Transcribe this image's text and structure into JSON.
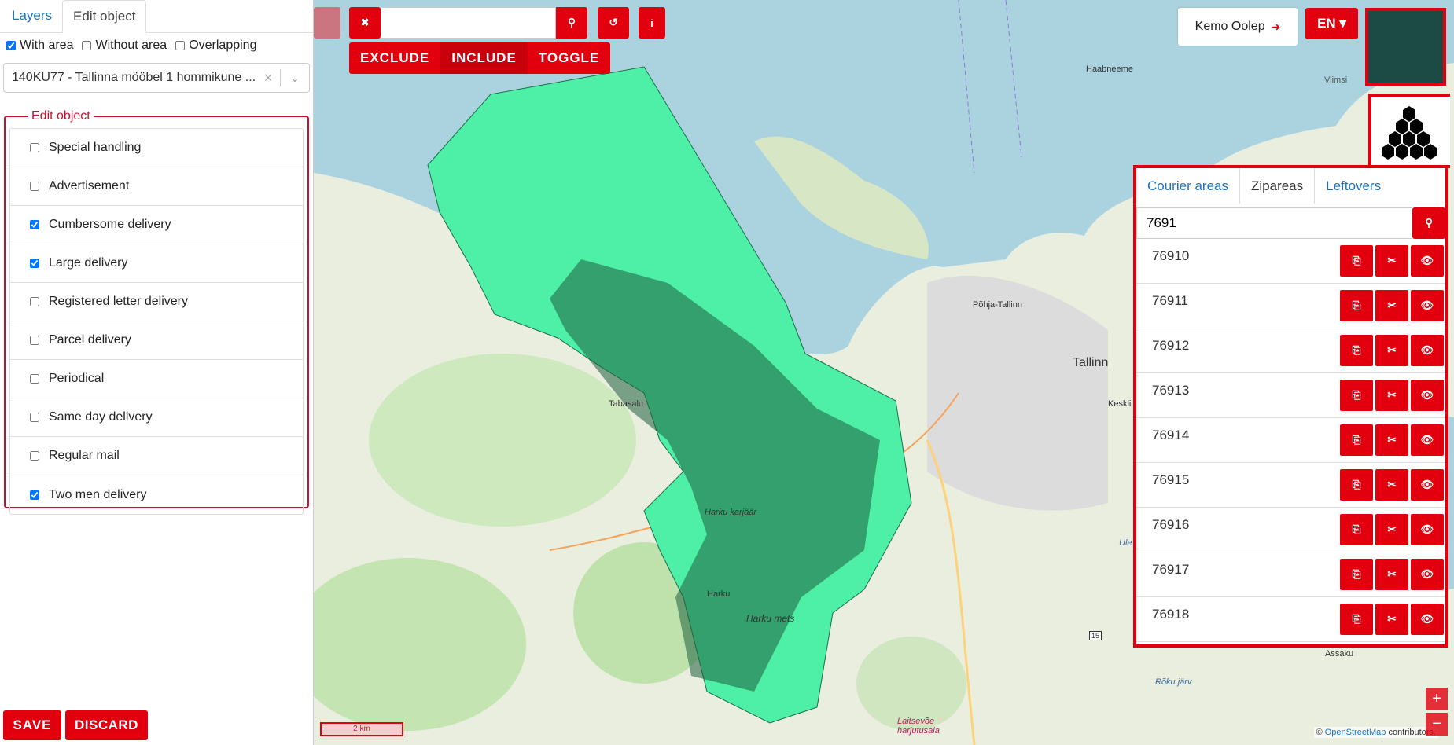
{
  "left": {
    "tabs": [
      "Layers",
      "Edit object"
    ],
    "filters": [
      {
        "label": "With area",
        "checked": true
      },
      {
        "label": "Without area",
        "checked": false
      },
      {
        "label": "Overlapping",
        "checked": false
      }
    ],
    "select_value": "140KU77 - Tallinna mööbel 1 hommikune ...",
    "select_clear": "×",
    "legend": "Edit object",
    "options": [
      {
        "label": "Special handling",
        "checked": false
      },
      {
        "label": "Advertisement",
        "checked": false
      },
      {
        "label": "Cumbersome delivery",
        "checked": true
      },
      {
        "label": "Large delivery",
        "checked": true
      },
      {
        "label": "Registered letter delivery",
        "checked": false
      },
      {
        "label": "Parcel delivery",
        "checked": false
      },
      {
        "label": "Periodical",
        "checked": false
      },
      {
        "label": "Same day delivery",
        "checked": false
      },
      {
        "label": "Regular mail",
        "checked": false
      },
      {
        "label": "Two men delivery",
        "checked": true
      }
    ],
    "save": "SAVE",
    "discard": "DISCARD"
  },
  "toolbar": {
    "close_glyph": "✖",
    "search_glyph": "⚲",
    "undo_glyph": "↺",
    "info_glyph": "i",
    "search_value": "",
    "modes": [
      "EXCLUDE",
      "INCLUDE",
      "TOGGLE"
    ]
  },
  "user": {
    "name": "Kemo Oolep",
    "logout_glyph": "➜"
  },
  "lang": "EN ▾",
  "panel": {
    "tabs": [
      "Courier areas",
      "Zipareas",
      "Leftovers"
    ],
    "search_value": "7691",
    "rows": [
      "76910",
      "76911",
      "76912",
      "76913",
      "76914",
      "76915",
      "76916",
      "76917",
      "76918"
    ]
  },
  "map": {
    "labels": [
      "Haabneeme",
      "Viimsi",
      "Põhja-Tallinn",
      "Tallinn",
      "Keskli",
      "Tabasalu",
      "Harku karjäär",
      "Harku",
      "Harku mets",
      "Ule",
      "Assaku",
      "Rõku järv",
      "Laitsevõe harjutusala",
      "15"
    ],
    "scale": "2 km",
    "attribution_prefix": "© ",
    "attribution_link": "OpenStreetMap",
    "attribution_suffix": " contributors.",
    "zoom_in": "+",
    "zoom_out": "−"
  },
  "colors": {
    "accent": "#e2000f",
    "link": "#1a74c4",
    "area_fill": "#4ef0a8",
    "sea": "#aad3df"
  }
}
